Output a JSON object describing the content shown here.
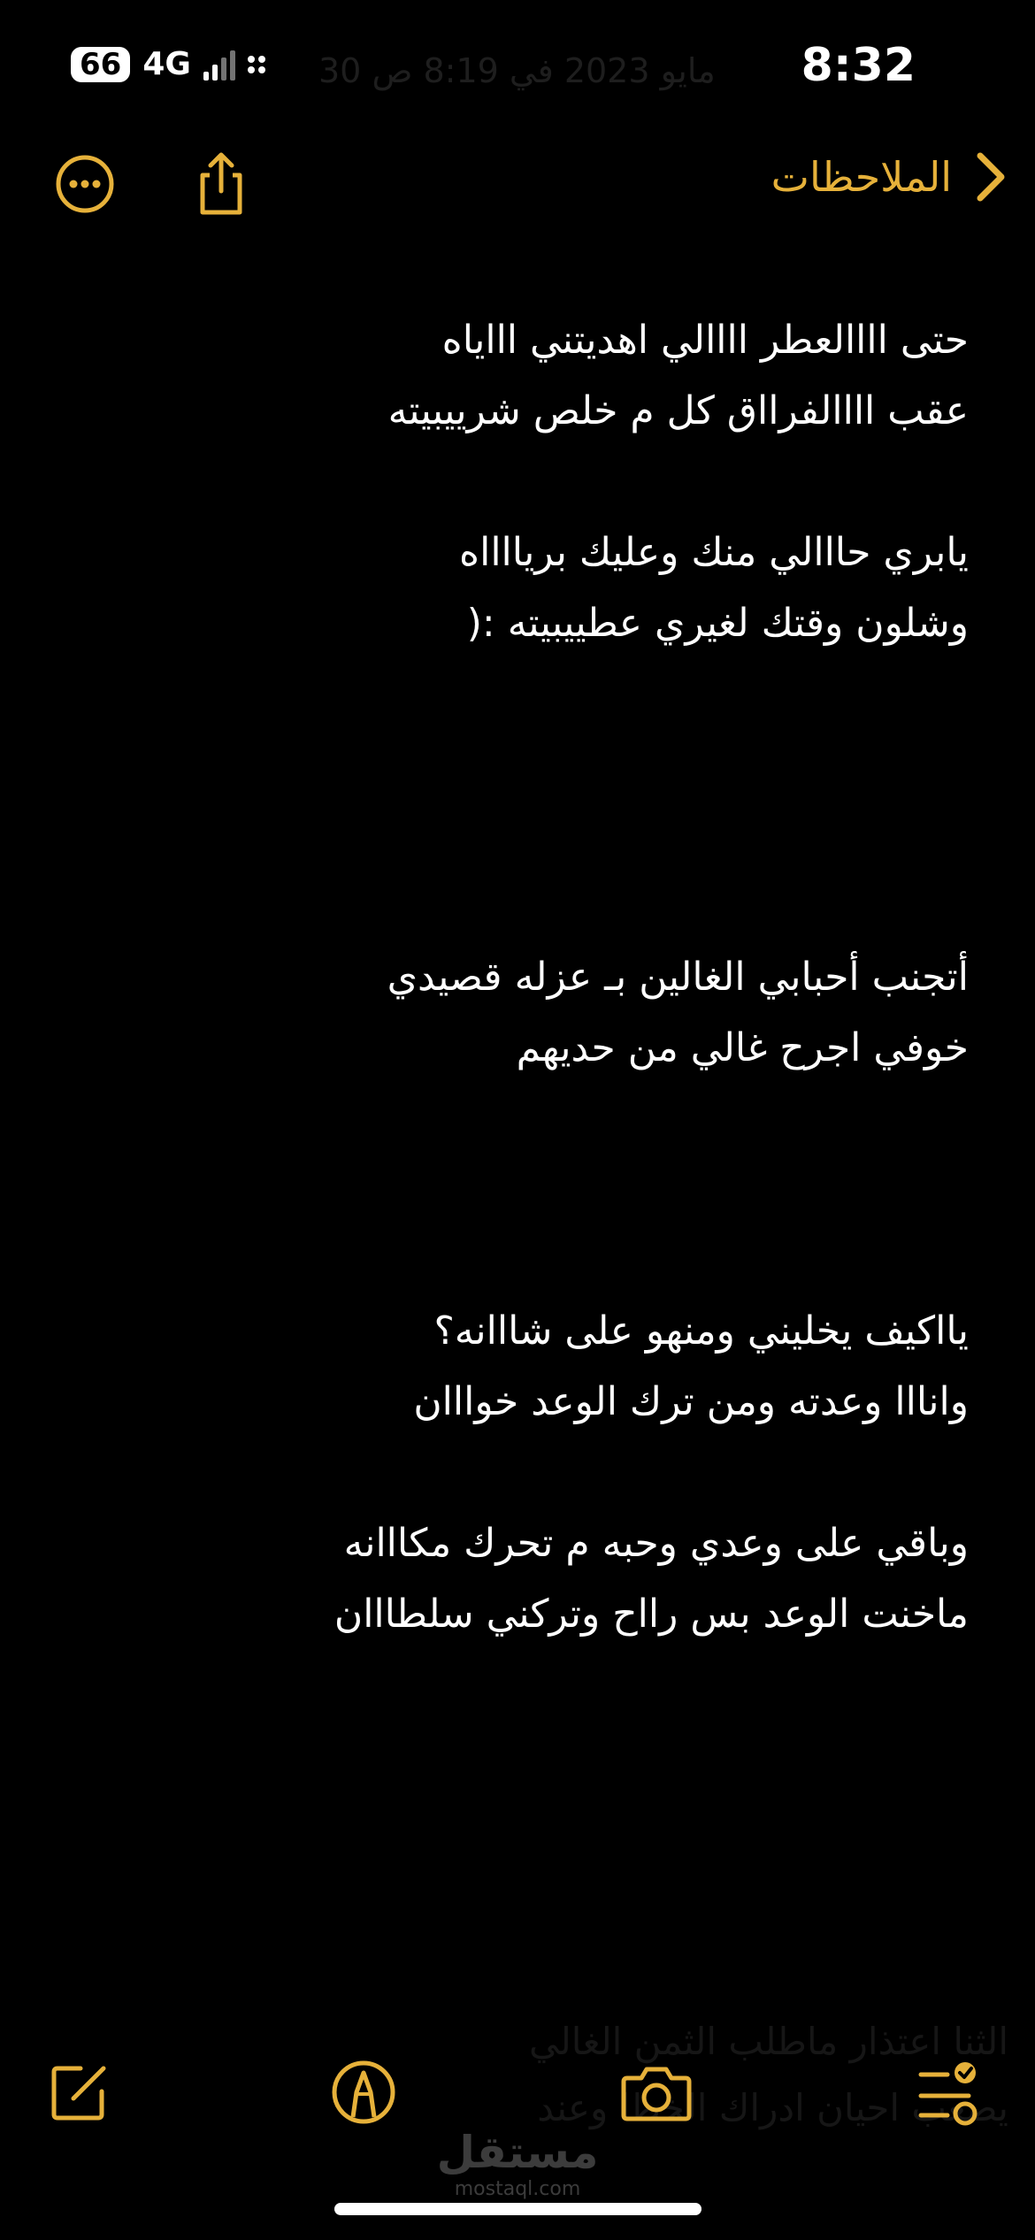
{
  "status_bar": {
    "battery": "66",
    "network": "4G",
    "time": "8:32",
    "ghost_date": "30 مايو 2023 في 8:19 ص"
  },
  "nav": {
    "back_label": "الملاحظات"
  },
  "note": {
    "stanza1": [
      "حتى اااالعطر اااالي اهديتني اااياه",
      "عقب اااالفرااق كل م خلص شرييبيته"
    ],
    "stanza2": [
      "يابري حااالي منك وعليك بريااااه",
      "وشلون وقتك لغيري عطييبيته :("
    ],
    "stanza3": [
      "أتجنب أحبابي الغالين بـ عزله قصيدي",
      "خوفي اجرح غالي من حديهم"
    ],
    "stanza4": [
      "يااكيف يخليني ومنهو على شااانه؟",
      "وانااا وعدته ومن ترك الوعد خوااان"
    ],
    "stanza5": [
      "وباقي على وعدي وحبه م تحرك مكااانه",
      "ماخنت الوعد بس رااح وتركني سلطااان"
    ]
  },
  "ghost_bottom": [
    "الثنا اعتذار ماطلب الثمن الغالي",
    "يصعب احيان ادراك الخطا وعند"
  ],
  "watermark": {
    "logo": "مستقل",
    "url": "mostaql.com"
  },
  "colors": {
    "accent": "#e6b13a",
    "background": "#000000",
    "text": "#ffffff"
  },
  "icons": {
    "more": "ellipsis-circle-icon",
    "share": "share-icon",
    "back": "chevron-left-icon",
    "compose": "compose-icon",
    "markup": "markup-pen-icon",
    "camera": "camera-icon",
    "checklist": "checklist-icon"
  }
}
